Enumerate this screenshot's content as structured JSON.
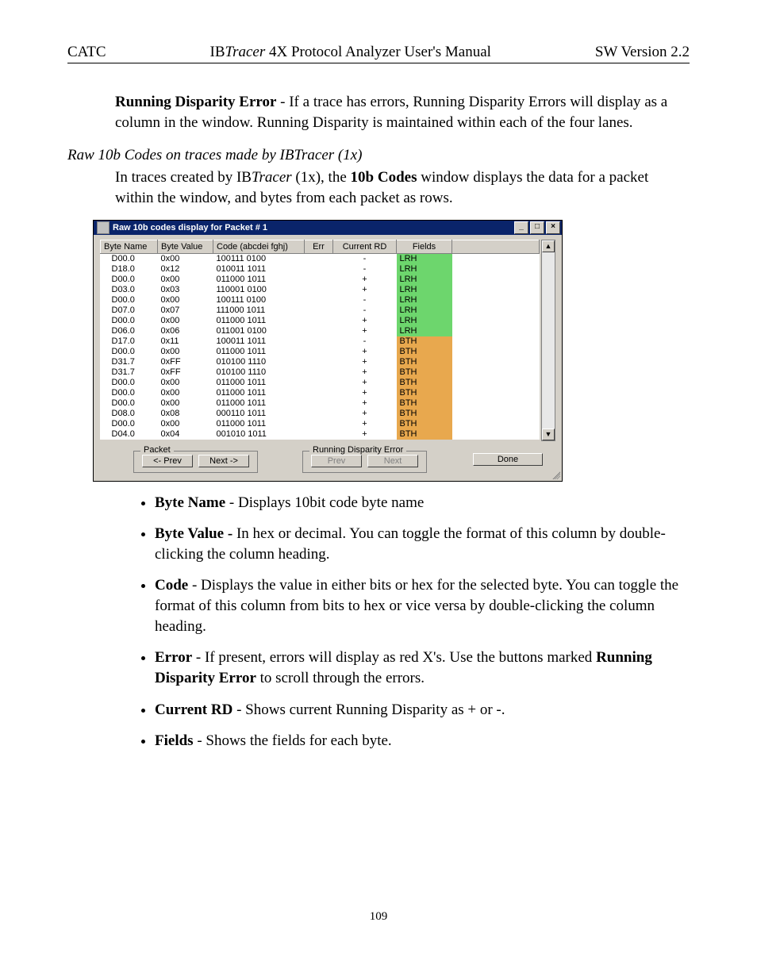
{
  "header": {
    "left": "CATC",
    "center_pre": "IB",
    "center_em": "Tracer",
    "center_post": " 4X Protocol Analyzer User's Manual",
    "right": "SW Version 2.2"
  },
  "para1": {
    "term": "Running Disparity Error",
    "rest": " - If a trace has errors, Running Disparity Errors will display as a column in the window.  Running Disparity is maintained within each of the four lanes."
  },
  "subhead": "Raw 10b Codes on traces made by IBTracer (1x)",
  "para2": {
    "p1": "In traces created by IB",
    "em": "Tracer",
    "p2": " (1x), the ",
    "bold": "10b Codes",
    "p3": " window displays the data for a packet within the window, and bytes from each packet as rows."
  },
  "win": {
    "title": "Raw 10b codes display for Packet # 1",
    "cols": [
      "Byte Name",
      "Byte Value",
      "Code (abcdei fghj)",
      "Err",
      "Current RD",
      "Fields"
    ],
    "rows": [
      [
        "D00.0",
        "0x00",
        "100111  0100",
        "",
        "-",
        "LRH",
        "lrh"
      ],
      [
        "D18.0",
        "0x12",
        "010011  1011",
        "",
        "-",
        "LRH",
        "lrh"
      ],
      [
        "D00.0",
        "0x00",
        "011000  1011",
        "",
        "+",
        "LRH",
        "lrh"
      ],
      [
        "D03.0",
        "0x03",
        "110001  0100",
        "",
        "+",
        "LRH",
        "lrh"
      ],
      [
        "D00.0",
        "0x00",
        "100111  0100",
        "",
        "-",
        "LRH",
        "lrh"
      ],
      [
        "D07.0",
        "0x07",
        "111000  1011",
        "",
        "-",
        "LRH",
        "lrh"
      ],
      [
        "D00.0",
        "0x00",
        "011000  1011",
        "",
        "+",
        "LRH",
        "lrh"
      ],
      [
        "D06.0",
        "0x06",
        "011001  0100",
        "",
        "+",
        "LRH",
        "lrh"
      ],
      [
        "D17.0",
        "0x11",
        "100011  1011",
        "",
        "-",
        "BTH",
        "bth"
      ],
      [
        "D00.0",
        "0x00",
        "011000  1011",
        "",
        "+",
        "BTH",
        "bth"
      ],
      [
        "D31.7",
        "0xFF",
        "010100  1110",
        "",
        "+",
        "BTH",
        "bth"
      ],
      [
        "D31.7",
        "0xFF",
        "010100  1110",
        "",
        "+",
        "BTH",
        "bth"
      ],
      [
        "D00.0",
        "0x00",
        "011000  1011",
        "",
        "+",
        "BTH",
        "bth"
      ],
      [
        "D00.0",
        "0x00",
        "011000  1011",
        "",
        "+",
        "BTH",
        "bth"
      ],
      [
        "D00.0",
        "0x00",
        "011000  1011",
        "",
        "+",
        "BTH",
        "bth"
      ],
      [
        "D08.0",
        "0x08",
        "000110  1011",
        "",
        "+",
        "BTH",
        "bth"
      ],
      [
        "D00.0",
        "0x00",
        "011000  1011",
        "",
        "+",
        "BTH",
        "bth"
      ],
      [
        "D04.0",
        "0x04",
        "001010  1011",
        "",
        "+",
        "BTH",
        "bth"
      ]
    ],
    "packet_legend": "Packet",
    "rde_legend": "Running Disparity Error",
    "btn_prev": "<- Prev",
    "btn_next": "Next ->",
    "btn_prev2": "Prev",
    "btn_next2": "Next",
    "btn_done": "Done"
  },
  "bullets": [
    {
      "term": "Byte Name",
      "dash": " - ",
      "rest": "Displays 10bit code byte name"
    },
    {
      "term": "Byte Value -",
      "dash": " ",
      "rest": "In hex or decimal.  You can toggle the format of this column by double-clicking the column heading."
    },
    {
      "term": "Code",
      "dash": " - ",
      "rest": "Displays the value in either bits or hex for the selected byte.  You can toggle the format of this column from bits to hex or vice versa by double-clicking the column heading."
    },
    {
      "term": "Error",
      "dash": " - ",
      "rest": "If present, errors will display as red X's.  Use the buttons marked ",
      "bold2": "Running Disparity Error",
      "rest2": " to scroll through the errors."
    },
    {
      "term": "Current RD",
      "dash": " - ",
      "rest": "Shows current Running Disparity as + or -."
    },
    {
      "term": "Fields",
      "dash": "  - ",
      "rest": "Shows the fields for each byte."
    }
  ],
  "pagenum": "109"
}
